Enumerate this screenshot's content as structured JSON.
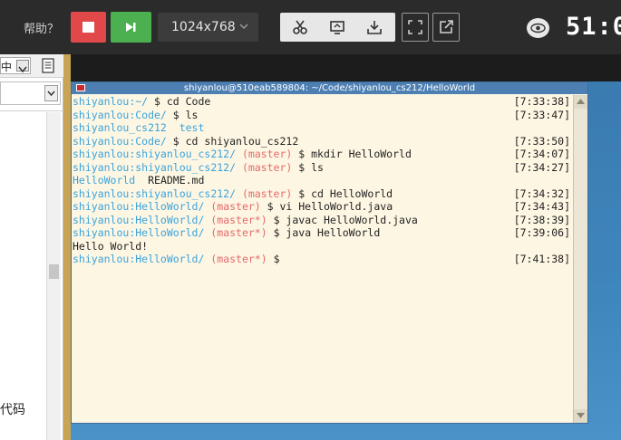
{
  "toolbar": {
    "help_label": "帮助？",
    "resolution": "1024x768",
    "timer": "51:0"
  },
  "icons": {
    "stop": "stop-icon",
    "run": "play-icon",
    "cut": "scissors-icon",
    "screen": "screenshot-icon",
    "download": "download-icon",
    "fullscreen": "fullscreen-icon",
    "popout": "popout-icon",
    "eye": "eye-icon"
  },
  "left_panel": {
    "ime_label": "中",
    "code_label": "代码"
  },
  "terminal": {
    "title": "shiyanlou@510eab589804: ~/Code/shiyanlou_cs212/HelloWorld",
    "lines": [
      {
        "user": "shiyanlou",
        "host": ":~/ ",
        "branch": "",
        "cmd": "$ cd Code",
        "ts": "[7:33:38]",
        "out": ""
      },
      {
        "user": "shiyanlou",
        "host": ":Code/ ",
        "branch": "",
        "cmd": "$ ls",
        "ts": "[7:33:47]",
        "out": ""
      },
      {
        "user": "",
        "host": "",
        "branch": "",
        "cmd": "",
        "ts": "",
        "out": "shiyanlou_cs212  test",
        "outcolor": "d"
      },
      {
        "user": "shiyanlou",
        "host": ":Code/ ",
        "branch": "",
        "cmd": "$ cd shiyanlou_cs212",
        "ts": "[7:33:50]",
        "out": ""
      },
      {
        "user": "shiyanlou",
        "host": ":shiyanlou_cs212/ ",
        "branch": "(master) ",
        "cmd": "$ mkdir HelloWorld",
        "ts": "[7:34:07]",
        "out": ""
      },
      {
        "user": "shiyanlou",
        "host": ":shiyanlou_cs212/ ",
        "branch": "(master) ",
        "cmd": "$ ls",
        "ts": "[7:34:27]",
        "out": ""
      },
      {
        "user": "",
        "host": "",
        "branch": "",
        "cmd": "",
        "ts": "",
        "out": "HelloWorld  README.md",
        "outcolor": "mixed"
      },
      {
        "user": "shiyanlou",
        "host": ":shiyanlou_cs212/ ",
        "branch": "(master) ",
        "cmd": "$ cd HelloWorld",
        "ts": "[7:34:32]",
        "out": ""
      },
      {
        "user": "shiyanlou",
        "host": ":HelloWorld/ ",
        "branch": "(master) ",
        "cmd": "$ vi HelloWorld.java",
        "ts": "[7:34:43]",
        "out": ""
      },
      {
        "user": "shiyanlou",
        "host": ":HelloWorld/ ",
        "branch": "(master*) ",
        "cmd": "$ javac HelloWorld.java",
        "ts": "[7:38:39]",
        "out": ""
      },
      {
        "user": "shiyanlou",
        "host": ":HelloWorld/ ",
        "branch": "(master*) ",
        "cmd": "$ java HelloWorld",
        "ts": "[7:39:06]",
        "out": ""
      },
      {
        "user": "",
        "host": "",
        "branch": "",
        "cmd": "",
        "ts": "",
        "out": "Hello World!",
        "outcolor": "c"
      },
      {
        "user": "shiyanlou",
        "host": ":HelloWorld/ ",
        "branch": "(master*) ",
        "cmd": "$",
        "ts": "[7:41:38]",
        "out": ""
      }
    ]
  },
  "colors": {
    "user": "#3aa3dc",
    "branch": "#e56a6a",
    "stop_button": "#e0484a",
    "run_button": "#4caf50"
  }
}
